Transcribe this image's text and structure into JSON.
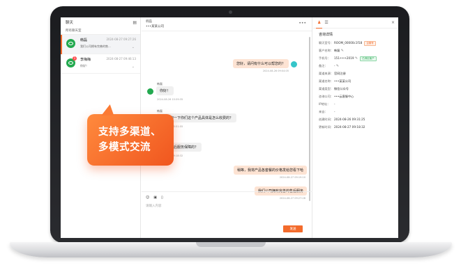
{
  "sidebar": {
    "title": "聊天",
    "subtitle": "所有聊天室",
    "conversations": [
      {
        "name": "韩磊",
        "time": "2024-08-27 09:27:26",
        "preview": "我们公司拥有完善的售...",
        "badge": ""
      },
      {
        "name": "李梅梅",
        "time": "2024-08-27 09:46:13",
        "preview": "你好！",
        "badge": "1"
      }
    ]
  },
  "chat": {
    "header_name": "韩磊",
    "header_company": "•••某某公司",
    "messages": [
      {
        "dir": "out",
        "text": "您好，请问有什么可以帮您的？",
        "time": "2024-08-26 09:04:05"
      },
      {
        "dir": "in",
        "sender": "韩磊",
        "text": "你好！",
        "time": "2024-08-26 15:59:35"
      },
      {
        "dir": "in",
        "sender": "韩磊",
        "text": "我想咨询一下你们这个产品具体是怎么收费的？",
        "time": "2024-08-26 15:51:55"
      },
      {
        "dir": "in",
        "sender": "",
        "text": "你们有售后服务保障的？",
        "time": "2024-08-27 09:18:32"
      },
      {
        "dir": "out",
        "text": "稍等，我将产品各套餐的价格发给您看下哈",
        "time": "2024-08-27 09:19:10"
      },
      {
        "dir": "out",
        "text": "我们公司拥有完善的售后服务",
        "time": "2024-08-27 09:27:28"
      }
    ],
    "input_placeholder": "请输入内容",
    "send_label": "发送"
  },
  "detail": {
    "tab_label": "咨询详情",
    "section_title": "咨询详情",
    "fields": [
      {
        "label": "聊天室号：",
        "value": "ROOM_00000c1f18",
        "tag": "企微号",
        "tag_color": "orange"
      },
      {
        "label": "客户名称：",
        "value": "韩磊"
      },
      {
        "label": "手机号：",
        "value": "151••••2019",
        "tag": "已绑定客户",
        "tag_color": "green"
      },
      {
        "label": "备注：",
        "value": "-"
      },
      {
        "label": "渠道来源：",
        "value": "官网注册"
      },
      {
        "label": "渠道名称：",
        "value": "•••某某公司"
      },
      {
        "label": "渠道类型：",
        "value": "微信公众号"
      },
      {
        "label": "咨询公司：",
        "value": "•••云客服中心"
      },
      {
        "label": "IP地址：",
        "value": "-"
      },
      {
        "label": "来自：",
        "value": "-"
      },
      {
        "label": "创建时间：",
        "value": "2024-08-26 09:31:25"
      },
      {
        "label": "更新时间：",
        "value": "2024-08-27 09:18:32"
      }
    ]
  },
  "promo": {
    "line1": "支持多渠道、",
    "line2": "多模式交流"
  },
  "colors": {
    "accent": "#f36b2c",
    "wechat_green": "#23a94f",
    "agent_avatar": "#35c5c9"
  }
}
